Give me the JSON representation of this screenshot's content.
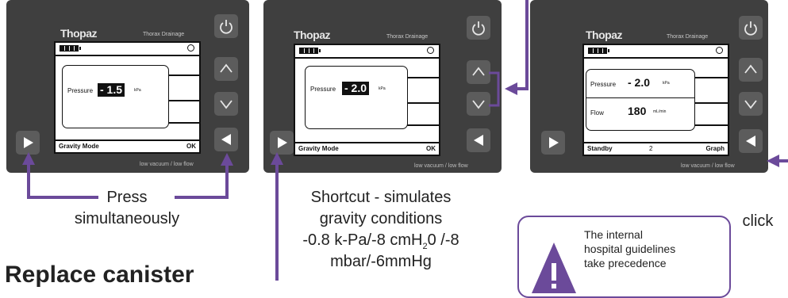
{
  "screens": [
    {
      "brand": "Thopaz",
      "subtitle": "Thorax Drainage",
      "footer": "low vacuum / low flow",
      "pressure_label": "Pressure",
      "pressure_value": "- 1.5",
      "pressure_unit": "kPa",
      "bottom_left": "Gravity Mode",
      "bottom_right": "OK"
    },
    {
      "brand": "Thopaz",
      "subtitle": "Thorax Drainage",
      "footer": "low vacuum / low flow",
      "pressure_label": "Pressure",
      "pressure_value": "- 2.0",
      "pressure_unit": "kPa",
      "bottom_left": "Gravity Mode",
      "bottom_right": "OK"
    },
    {
      "brand": "Thopaz",
      "subtitle": "Thorax Drainage",
      "footer": "low vacuum / low flow",
      "pressure_label": "Pressure",
      "pressure_value": "- 2.0",
      "pressure_unit": "kPa",
      "flow_label": "Flow",
      "flow_value": "180",
      "flow_unit": "mL/min",
      "bottom_left": "Standby",
      "bottom_mid": "2",
      "bottom_right": "Graph"
    }
  ],
  "captions": {
    "press_line1": "Press",
    "press_line2": "simultaneously",
    "shortcut_line1": "Shortcut - simulates",
    "shortcut_line2": "gravity conditions",
    "shortcut_line3a": "-0.8 k-Pa/-8 cmH",
    "shortcut_line3_sub": "2",
    "shortcut_line3b": "0 /-8",
    "shortcut_line4": "mbar/-6mmHg",
    "click": "click"
  },
  "callout": {
    "line1": "The internal",
    "line2": "hospital guidelines",
    "line3": "take precedence"
  },
  "heading": "Replace canister",
  "colors": {
    "arrow_purple": "#6b4a9a",
    "device_body": "#3f3f3f"
  }
}
